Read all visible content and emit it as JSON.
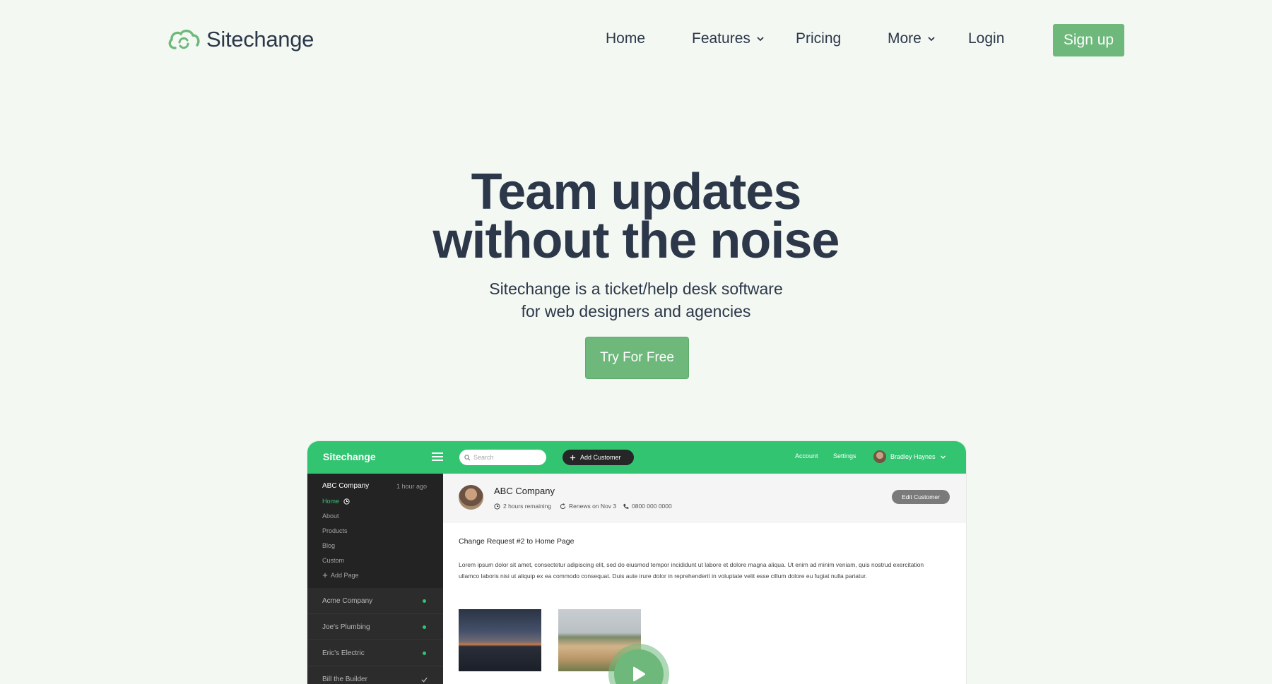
{
  "brand": {
    "name": "Sitechange",
    "accent": "#6db87a",
    "text": "#2c3849"
  },
  "nav": {
    "items": [
      {
        "label": "Home"
      },
      {
        "label": "Features"
      },
      {
        "label": "Pricing"
      },
      {
        "label": "More"
      },
      {
        "label": "Login"
      }
    ],
    "signup": "Sign up"
  },
  "hero": {
    "title_line1": "Team updates",
    "title_line2": "without the noise",
    "sub_line1": "Sitechange is a ticket/help desk software",
    "sub_line2": "for web designers and agencies",
    "cta": "Try For Free"
  },
  "app": {
    "brand": "Sitechange",
    "bar_color": "#33c472",
    "search_placeholder": "Search",
    "add_customer": "Add Customer",
    "account": "Account",
    "settings": "Settings",
    "user_name": "Bradley Haynes",
    "sidebar": {
      "company": "ABC Company",
      "time": "1 hour ago",
      "pages": [
        "Home",
        "About",
        "Products",
        "Blog",
        "Custom",
        "Add Page"
      ],
      "customers": [
        "Acme Company",
        "Joe's Plumbing",
        "Eric's Electric",
        "Bill the Builder"
      ]
    },
    "customer": {
      "name": "ABC Company",
      "remaining": "2 hours remaining",
      "renews": "Renews on Nov 3",
      "phone": "0800 000 0000",
      "edit": "Edit Customer"
    },
    "request": {
      "title": "Change Request #2 to Home Page",
      "body": "Lorem ipsum dolor sit amet, consectetur adipiscing elit, sed do eiusmod tempor incididunt ut labore et dolore magna aliqua. Ut enim ad minim veniam, quis nostrud exercitation ullamco laboris nisi ut aliquip ex ea commodo consequat. Duis aute irure dolor in reprehenderit in voluptate velit esse cillum dolore eu fugiat nulla pariatur."
    }
  }
}
